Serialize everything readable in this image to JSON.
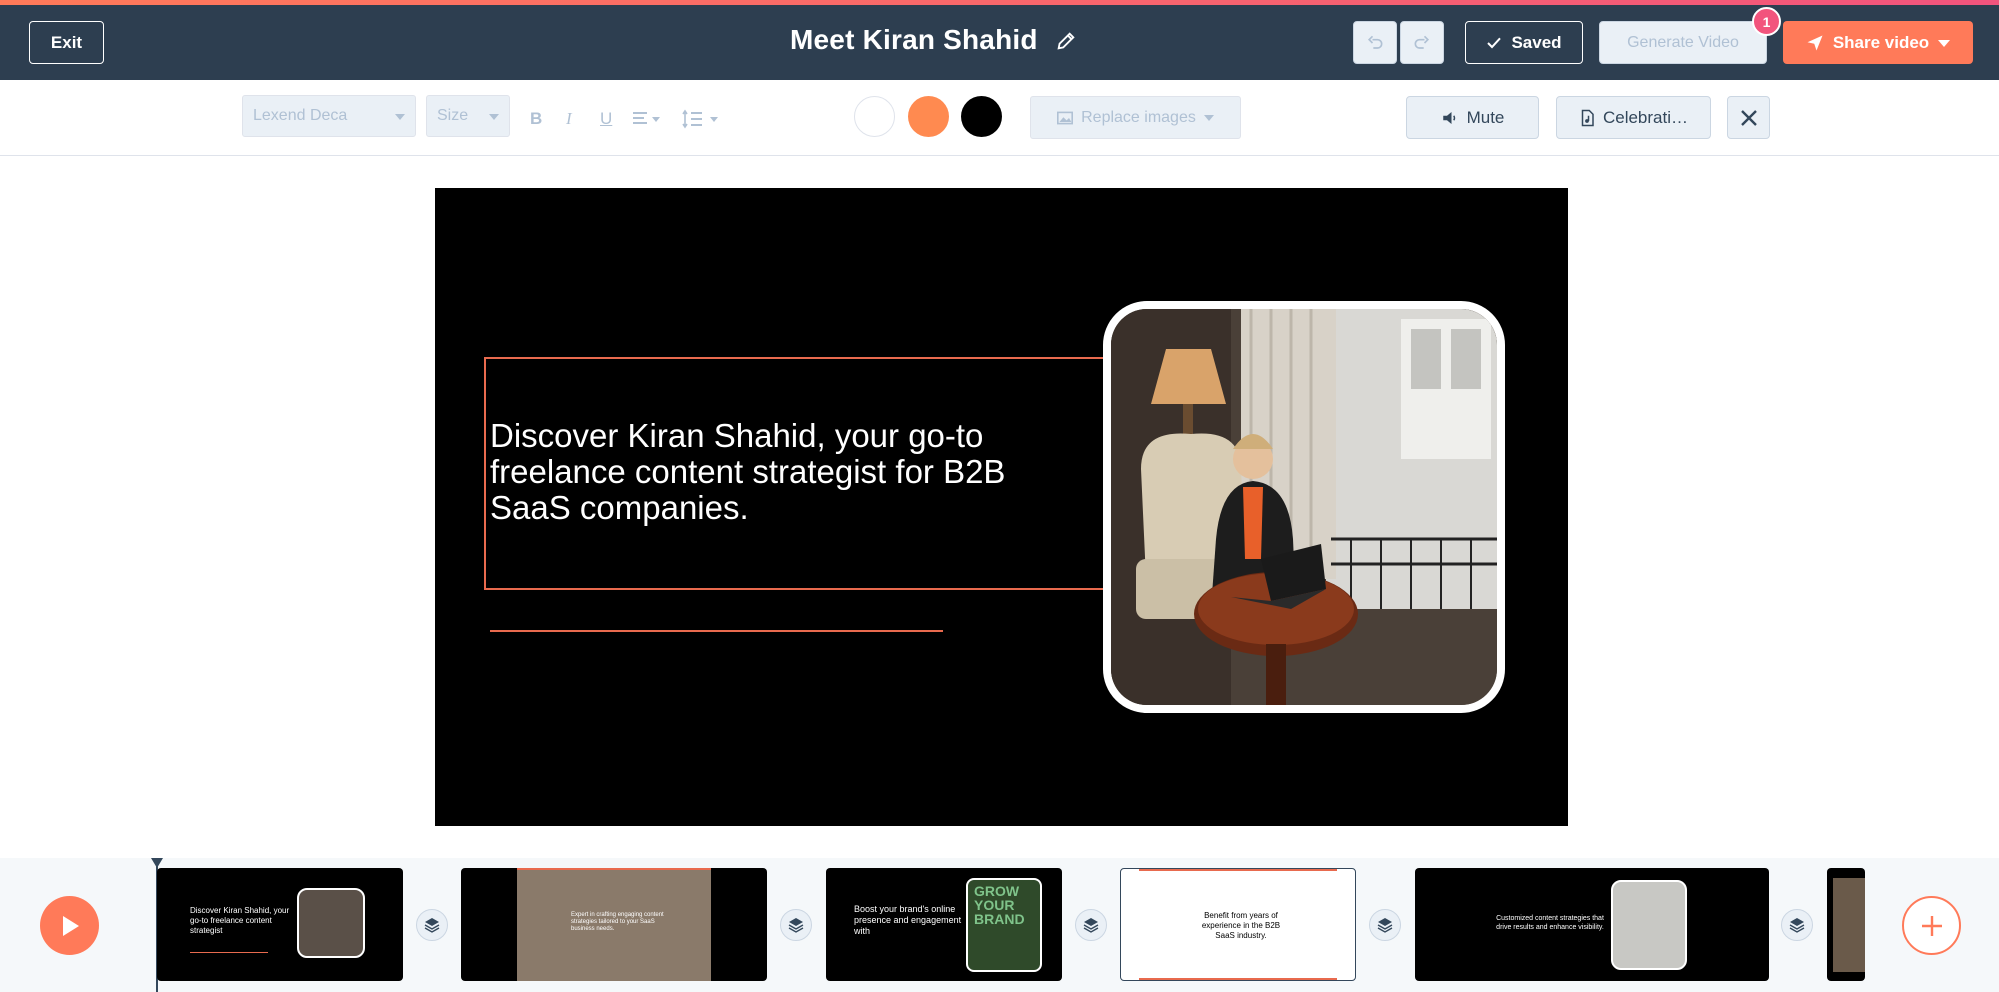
{
  "header": {
    "exit_label": "Exit",
    "title": "Meet Kiran Shahid",
    "saved_label": "Saved",
    "generate_label": "Generate Video",
    "notification_count": "1",
    "share_label": "Share video"
  },
  "toolbar": {
    "font_value": "Lexend Deca",
    "size_value": "Size",
    "bold": "B",
    "italic": "I",
    "underline": "U",
    "replace_images_label": "Replace images",
    "mute_label": "Mute",
    "music_label": "Celebrati…",
    "swatches": [
      "#ffffff",
      "#ff8a50",
      "#000000"
    ]
  },
  "slide": {
    "headline": "Discover Kiran Shahid, your go-to freelance content strategist for B2B SaaS companies.",
    "accent_color": "#e86a4e"
  },
  "timeline": {
    "thumbnails": [
      {
        "text": "Discover Kiran Shahid, your go-to freelance content strategist"
      },
      {
        "text": "Expert in crafting engaging content strategies tailored to your SaaS business needs."
      },
      {
        "text": "Boost your brand's online presence and engagement with",
        "badge_text": "GROW YOUR BRAND"
      },
      {
        "text": "Benefit from years of experience in the B2B SaaS industry."
      },
      {
        "text": "Customized content strategies that drive results and enhance visibility."
      },
      {
        "text": ""
      }
    ]
  }
}
